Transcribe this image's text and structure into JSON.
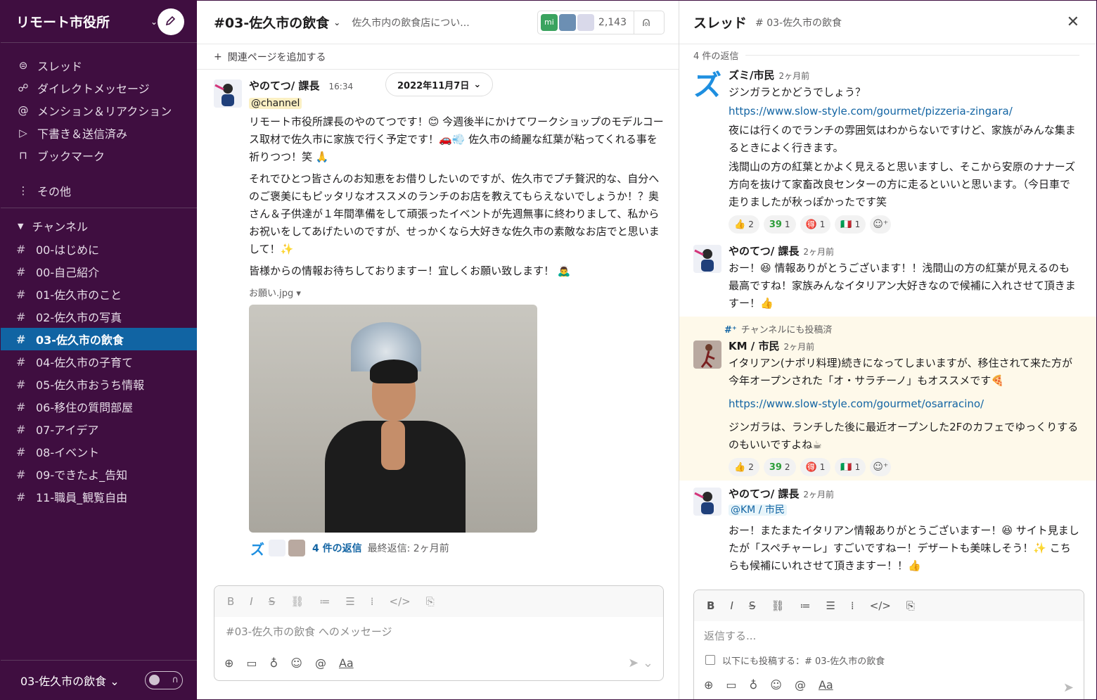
{
  "workspace": {
    "name": "リモート市役所"
  },
  "nav": [
    {
      "icon": "thread-icon",
      "label": "スレッド"
    },
    {
      "icon": "dm-icon",
      "label": "ダイレクトメッセージ"
    },
    {
      "icon": "at-icon",
      "label": "メンション＆リアクション"
    },
    {
      "icon": "send-icon",
      "label": "下書き＆送信済み"
    },
    {
      "icon": "bookmark-icon",
      "label": "ブックマーク"
    }
  ],
  "more_label": "その他",
  "channels_label": "チャンネル",
  "channels": [
    "00-はじめに",
    "00-自己紹介",
    "01-佐久市のこと",
    "02-佐久市の写真",
    "03-佐久市の飲食",
    "04-佐久市の子育て",
    "05-佐久市おうち情報",
    "06-移住の質問部屋",
    "07-アイデア",
    "08-イベント",
    "09-できたよ_告知",
    "11-職員_観覧自由"
  ],
  "footer": {
    "channel": "03-佐久市の飲食"
  },
  "channel": {
    "title": "#03-佐久市の飲食",
    "topic": "佐久市内の飲食店につい...",
    "member_badge": "mi",
    "member_count": "2,143",
    "add_bookmark": "関連ページを追加する"
  },
  "main_message": {
    "author": "やのてつ/ 課長",
    "time": "16:34",
    "date_pill": "2022年11月7日",
    "mention": "@channel",
    "p1": "リモート市役所課長のやのてつです！😊 今週後半にかけてワークショップのモデルコース取材で佐久市に家族で行く予定です！🚗💨 佐久市の綺麗な紅葉が粘ってくれる事を祈りつつ！笑 🙏",
    "p2": "それでひとつ皆さんのお知恵をお借りしたいのですが、佐久市でプチ贅沢的な、自分へのご褒美にもピッタリなオススメのランチのお店を教えてもらえないでしょうか！？奥さん＆子供達が１年間準備をして頑張ったイベントが先週無事に終わりまして、私からお祝いをしてあげたいのですが、せっかくなら大好きな佐久市の素敵なお店でと思いまして！✨",
    "p3": "皆様からの情報お待ちしておりますー！宜しくお願い致します！ 🙇‍♂️",
    "file_name": "お願い.jpg",
    "reply_count": "4 件の返信",
    "last_reply": "最終返信: 2ヶ月前"
  },
  "composer": {
    "placeholder": "#03-佐久市の飲食 へのメッセージ",
    "aa": "Aa"
  },
  "thread": {
    "title": "スレッド",
    "subtitle": "# 03-佐久市の飲食",
    "reply_count": "4 件の返信",
    "posted_to": "チャンネルにも投稿済",
    "messages": [
      {
        "author": "ズミ/市民",
        "time": "2ヶ月前",
        "lines": [
          "ジンガラとかどうでしょう？",
          "https://www.slow-style.com/gourmet/pizzeria-zingara/",
          "夜には行くのでランチの雰囲気はわからないですけど、家族がみんな集まるときによく行きます。",
          "浅間山の方の紅葉とかよく見えると思いますし、そこから安原のナナーズ方向を抜けて家畜改良センターの方に走るといいと思います。（今日車で走りましたが秋っぽかったです笑"
        ],
        "reactions": [
          {
            "emoji": "👍",
            "count": "2"
          },
          {
            "emoji": "39",
            "count": "1"
          },
          {
            "emoji": "🉐",
            "count": "1"
          },
          {
            "emoji": "🇮🇹",
            "count": "1"
          }
        ]
      },
      {
        "author": "やのてつ/ 課長",
        "time": "2ヶ月前",
        "lines": [
          "おー！😆 情報ありがとうございます！！浅間山の方の紅葉が見えるのも最高ですね！家族みんなイタリアン大好きなので候補に入れさせて頂きますー！👍"
        ]
      },
      {
        "author": "KM / 市民",
        "time": "2ヶ月前",
        "lines": [
          "イタリアン(ナポリ料理)続きになってしまいますが、移住されて来た方が今年オープンされた「オ・サラチーノ」もオススメです🍕",
          "https://www.slow-style.com/gourmet/osarracino/",
          "ジンガラは、ランチした後に最近オープンした2Fのカフェでゆっくりするのもいいですよね☕"
        ],
        "reactions": [
          {
            "emoji": "👍",
            "count": "2"
          },
          {
            "emoji": "39",
            "count": "2"
          },
          {
            "emoji": "🉐",
            "count": "1"
          },
          {
            "emoji": "🇮🇹",
            "count": "1"
          }
        ]
      },
      {
        "author": "やのてつ/ 課長",
        "time": "2ヶ月前",
        "mention": "@KM / 市民",
        "lines": [
          "おー！またまたイタリアン情報ありがとうございますー！😆 サイト見ましたが「スペチャーレ」すごいですねー！デザートも美味しそう！✨ こちらも候補にいれさせて頂きますー！！👍"
        ]
      }
    ],
    "composer": {
      "placeholder": "返信する...",
      "also_post": "以下にも投稿する：# 03-佐久市の飲食",
      "aa": "Aa"
    }
  }
}
